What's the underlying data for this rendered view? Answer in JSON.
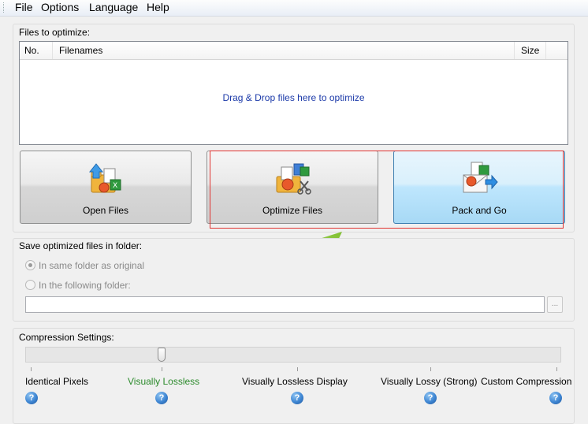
{
  "menu": {
    "items": [
      {
        "label": "File"
      },
      {
        "label": "Options"
      },
      {
        "label": "Language"
      },
      {
        "label": "Help"
      }
    ]
  },
  "files": {
    "group_label": "Files to optimize:",
    "columns": [
      "No.",
      "Filenames",
      "Size"
    ],
    "drop_hint": "Drag & Drop files here to optimize"
  },
  "buttons": {
    "open_files": "Open Files",
    "optimize_files": "Optimize Files",
    "pack_and_go": "Pack and Go"
  },
  "save": {
    "group_label": "Save optimized files in folder:",
    "option_same": "In same folder as original",
    "option_following": "In the following folder:",
    "folder_value": "",
    "browse_label": "..."
  },
  "compression": {
    "group_label": "Compression Settings:",
    "selected_level": 1,
    "levels": [
      {
        "label": "Identical Pixels"
      },
      {
        "label": "Visually Lossless"
      },
      {
        "label": "Visually Lossless Display"
      },
      {
        "label": "Visually Lossy (Strong)"
      },
      {
        "label": "Custom Compression"
      }
    ],
    "help_glyph": "?"
  },
  "colors": {
    "annotation_red": "#e0322f",
    "annotation_arrow_green": "#8cc63f",
    "selected_level_green": "#2b8a2b",
    "drop_hint_blue": "#1c3aa9"
  },
  "icons": {
    "open_files": "folder-with-documents-icon",
    "optimize_files": "optimize-documents-icon",
    "pack_and_go": "email-pack-icon",
    "help": "help-icon"
  }
}
